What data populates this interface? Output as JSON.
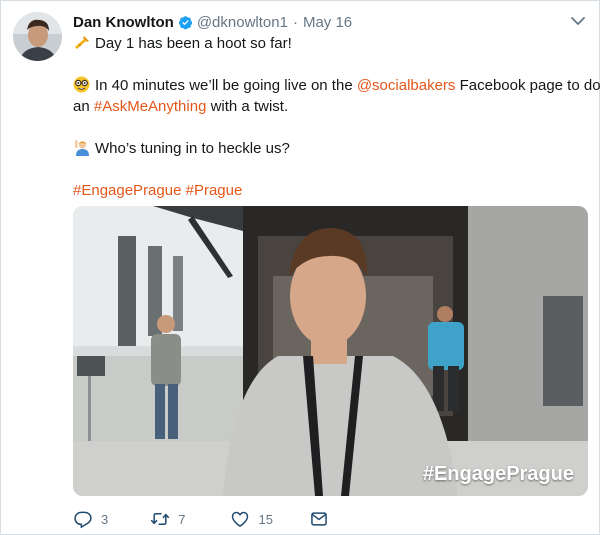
{
  "tweet": {
    "author_name": "Dan Knowlton",
    "handle": "@dknowlton1",
    "separator": "·",
    "date": "May 16",
    "lines": [
      {
        "emoji": "trumpet-emoji",
        "parts": [
          {
            "text": "Day 1 has been a hoot so far!",
            "type": "text"
          }
        ]
      },
      {
        "emoji": "nerd-face-emoji",
        "parts": [
          {
            "text": "In 40 minutes we’ll be going live on the ",
            "type": "text"
          },
          {
            "text": "@socialbakers",
            "type": "link"
          },
          {
            "text": " Facebook page to do",
            "type": "text"
          }
        ]
      },
      {
        "emoji": null,
        "parts": [
          {
            "text": "an ",
            "type": "text"
          },
          {
            "text": "#AskMeAnything",
            "type": "link"
          },
          {
            "text": " with a twist.",
            "type": "text"
          }
        ]
      },
      {
        "emoji": "person-raising-hand-emoji",
        "parts": [
          {
            "text": "Who’s tuning in to heckle us?",
            "type": "text"
          }
        ]
      },
      {
        "emoji": null,
        "parts": [
          {
            "text": "#EngagePrague",
            "type": "link"
          },
          {
            "text": " ",
            "type": "text"
          },
          {
            "text": "#Prague",
            "type": "link"
          }
        ]
      }
    ],
    "media_overlay_text": "#EngagePrague",
    "actions": {
      "reply_count": "3",
      "retweet_count": "7",
      "like_count": "15"
    }
  },
  "colors": {
    "link": "#e4571b",
    "verified": "#1da1f2",
    "muted": "#657786"
  },
  "icons": [
    "verified-badge-icon",
    "chevron-down-icon",
    "reply-icon",
    "retweet-icon",
    "like-icon",
    "direct-message-icon"
  ]
}
